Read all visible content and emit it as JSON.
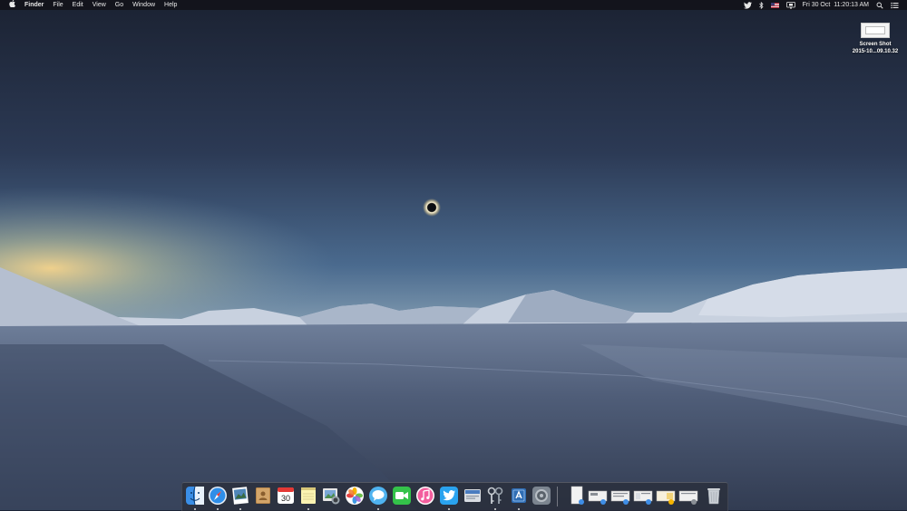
{
  "menubar": {
    "apple": "",
    "app_name": "Finder",
    "menus": [
      "File",
      "Edit",
      "View",
      "Go",
      "Window",
      "Help"
    ],
    "status_icons": [
      "twitter-icon",
      "bluetooth-icon",
      "us-flag-icon",
      "display-icon"
    ],
    "clock": "Fri 30 Oct  11:20:13 AM",
    "right_icons": [
      "spotlight-search-icon",
      "notification-center-icon"
    ]
  },
  "desktop": {
    "icon_label_line1": "Screen Shot",
    "icon_label_line2": "2015-10...09.10.32"
  },
  "dock": {
    "apps": [
      "finder",
      "safari",
      "preview",
      "contacts",
      "calendar",
      "notes",
      "image-capture",
      "photos",
      "messages",
      "facetime",
      "itunes",
      "twitter",
      "directory-utility",
      "keychain-access",
      "xcode",
      "system-preferences"
    ],
    "calendar_day": "30",
    "minimized_windows": 6,
    "trash": "trash"
  }
}
